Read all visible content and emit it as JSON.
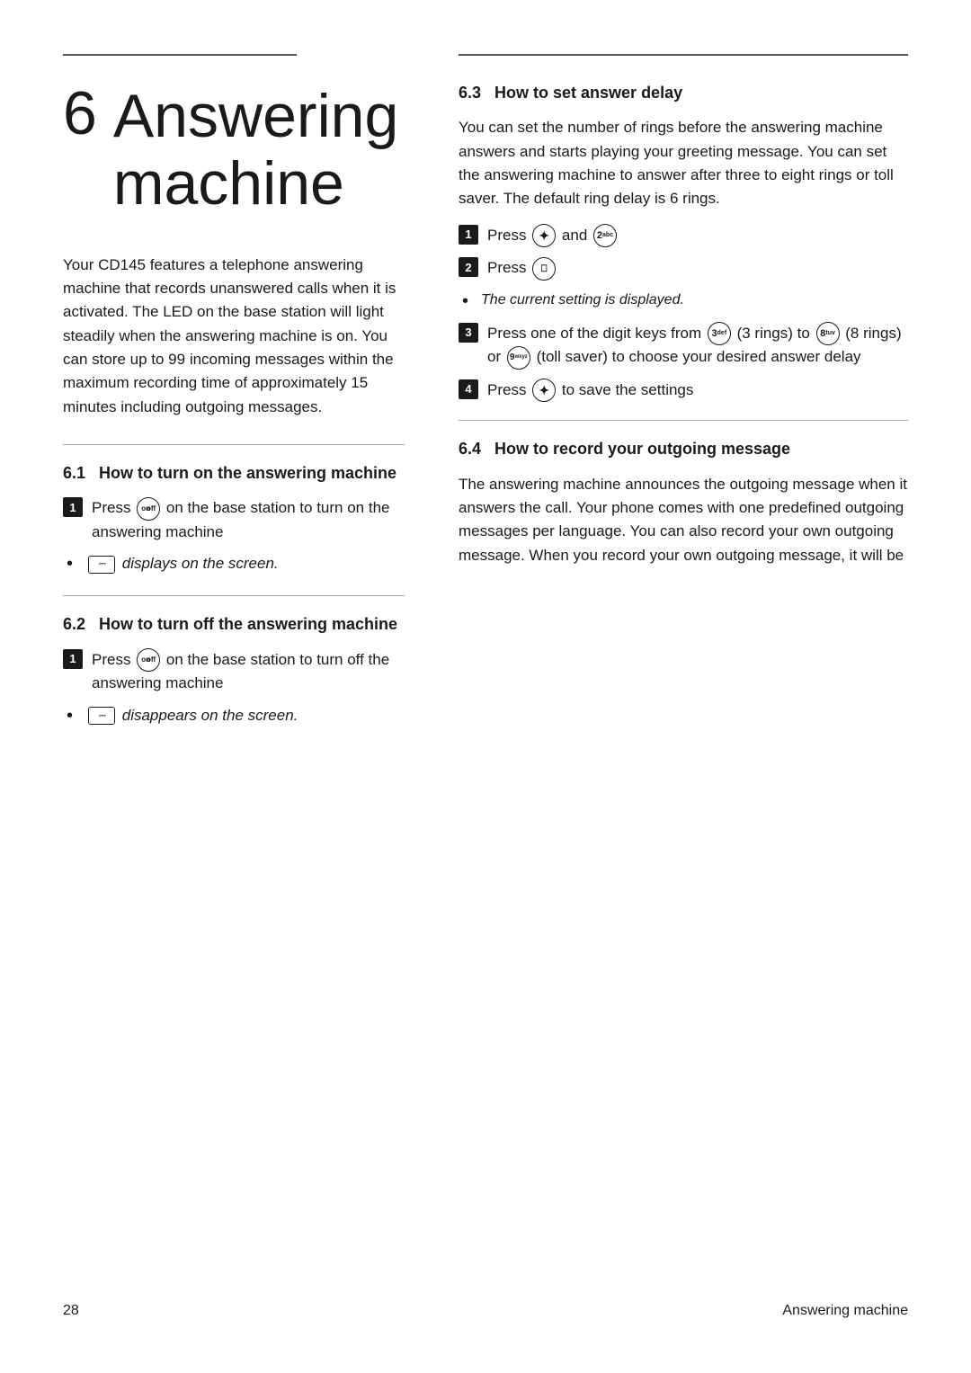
{
  "page": {
    "number": "28",
    "footer_title": "Answering machine",
    "top_rule_left": true,
    "top_rule_right": true
  },
  "chapter": {
    "number": "6",
    "title": "Answering machine",
    "intro": "Your CD145 features a telephone answering machine that records unanswered calls when it is activated. The LED on the base station will light steadily when the answering machine is on. You can store up to 99 incoming messages within the maximum recording time of approximately 15 minutes including outgoing messages."
  },
  "sections": {
    "s6_1": {
      "heading": "6.1    How to turn on the answering machine",
      "step1": "Press",
      "step1_icon": "on/off",
      "step1_text": "on the base station to turn on the answering machine",
      "bullet_icon_label": "screen-icon",
      "bullet_text": "displays on the screen."
    },
    "s6_2": {
      "heading": "6.2    How to turn off the answering machine",
      "step1": "Press",
      "step1_icon": "on/off",
      "step1_text": "on the base station to turn off the answering machine",
      "bullet_text": "disappears on the screen."
    },
    "s6_3": {
      "heading": "6.3    How to set answer delay",
      "intro": "You can set the number of rings before the answering machine answers and starts playing your greeting message. You can set the answering machine to answer after three to eight rings or toll saver. The default ring delay is 6 rings.",
      "step1": "Press",
      "step1_icon1": "navigate",
      "step1_connector": "and",
      "step1_icon2": "2",
      "step2": "Press",
      "step2_icon": "menu",
      "bullet_italic": "The current setting is displayed.",
      "step3": "Press one of the digit keys from",
      "step3_icon1": "3",
      "step3_text1": "(3 rings) to",
      "step3_icon2": "8",
      "step3_text2": "(8 rings) or",
      "step3_icon3": "9",
      "step3_text3": "(toll saver) to choose your desired answer delay",
      "step4": "Press",
      "step4_icon": "navigate",
      "step4_text": "to save the settings"
    },
    "s6_4": {
      "heading": "6.4    How to record your outgoing message",
      "intro": "The answering machine announces the outgoing message when it answers the call. Your phone comes with one predefined outgoing messages per language. You can also record your own outgoing message. When you record your own outgoing message, it will be"
    }
  }
}
